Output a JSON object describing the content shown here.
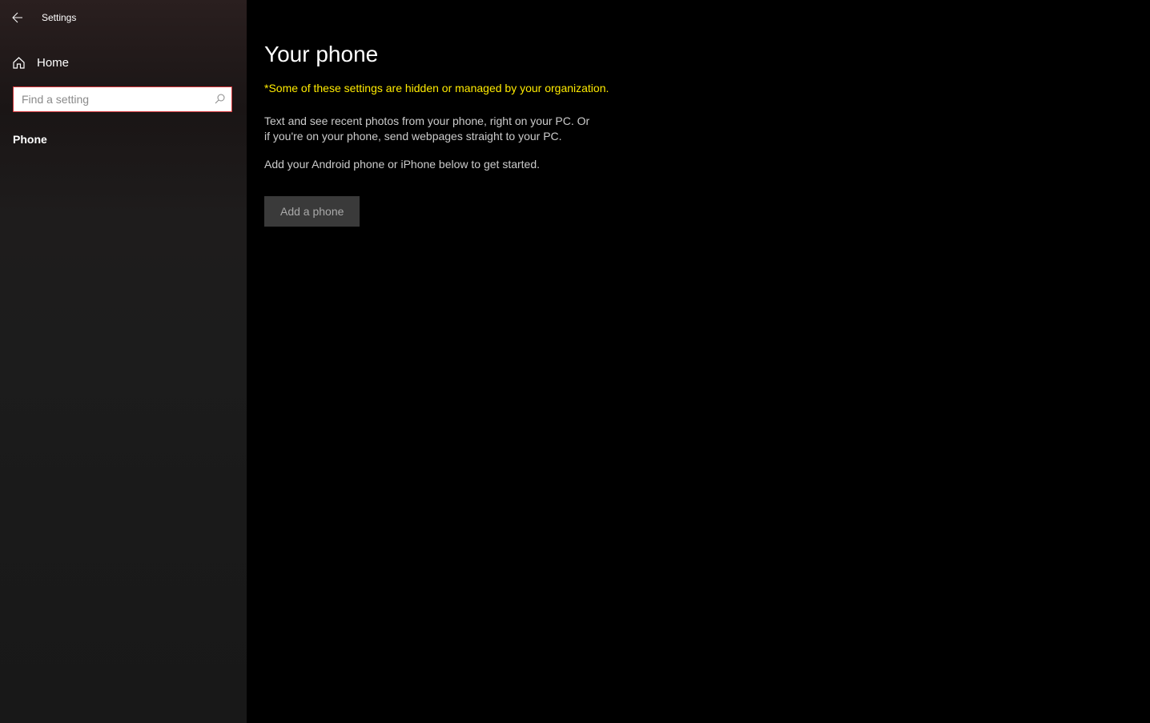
{
  "header": {
    "title": "Settings"
  },
  "sidebar": {
    "home_label": "Home",
    "search_placeholder": "Find a setting",
    "nav_items": [
      {
        "label": "Phone"
      }
    ]
  },
  "main": {
    "title": "Your phone",
    "org_warning": "*Some of these settings are hidden or managed by your organization.",
    "description_1": "Text and see recent photos from your phone, right on your PC. Or if you're on your phone, send webpages straight to your PC.",
    "description_2": "Add your Android phone or iPhone below to get started.",
    "add_button_label": "Add a phone"
  }
}
